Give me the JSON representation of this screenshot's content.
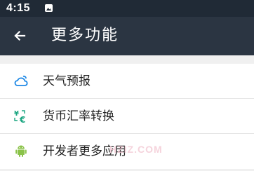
{
  "status_bar": {
    "time": "4:15",
    "notification_icon": "image-notification-icon"
  },
  "app_bar": {
    "back_icon": "arrow-left-icon",
    "title": "更多功能"
  },
  "menu": {
    "items": [
      {
        "label": "天气预报",
        "icon": "weather-cloud-icon",
        "icon_color": "#1e88e5"
      },
      {
        "label": "货币汇率转换",
        "icon": "currency-exchange-icon",
        "icon_color": "#1aa580"
      },
      {
        "label": "开发者更多应用",
        "icon": "android-icon",
        "icon_color": "#8bc34a"
      }
    ]
  },
  "watermark": "HZIZ.COM",
  "colors": {
    "status_bar": "#202a36",
    "app_bar": "#2b3542",
    "background": "#f0f0f0",
    "list_background": "#ffffff"
  }
}
